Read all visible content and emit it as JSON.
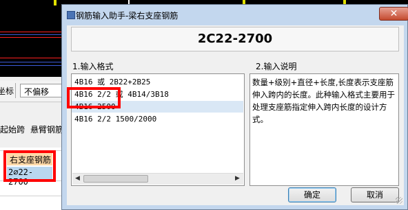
{
  "background_app": {
    "toolbar": {
      "coord_label": "坐标",
      "offset_dropdown": "不偏移"
    },
    "row2": {
      "start_span": "起始跨",
      "cantilever": "悬臂钢筋"
    },
    "grid": {
      "header": "右支座钢筋",
      "cell_value": "2⌀22-2700"
    }
  },
  "dialog": {
    "title": "钢筋输入助手-梁右支座钢筋",
    "close_label": "✕",
    "code_display": "2C22-2700",
    "format_section_label": "1.输入格式",
    "desc_section_label": "2.输入说明",
    "format_items": [
      "4B16 或 2B22+2B25",
      "4B16 2/2 或 4B14/3B18",
      "4B16-2500",
      "4B16 2/2 1500/2000"
    ],
    "selected_index": 2,
    "description": "数量+级别+直径+长度,长度表示支座筋伸入跨内的长度。此种输入格式主要用于处理支座筋指定伸入跨内长度的设计方式。",
    "ok_label": "确定",
    "cancel_label": "取消"
  },
  "colors": {
    "highlight_red": "#ff0000",
    "dialog_frame": "#c3d7ee",
    "selected_row": "#d9e7f5",
    "grid_header": "#ffd9a8",
    "grid_cell": "#b9d7ef"
  }
}
